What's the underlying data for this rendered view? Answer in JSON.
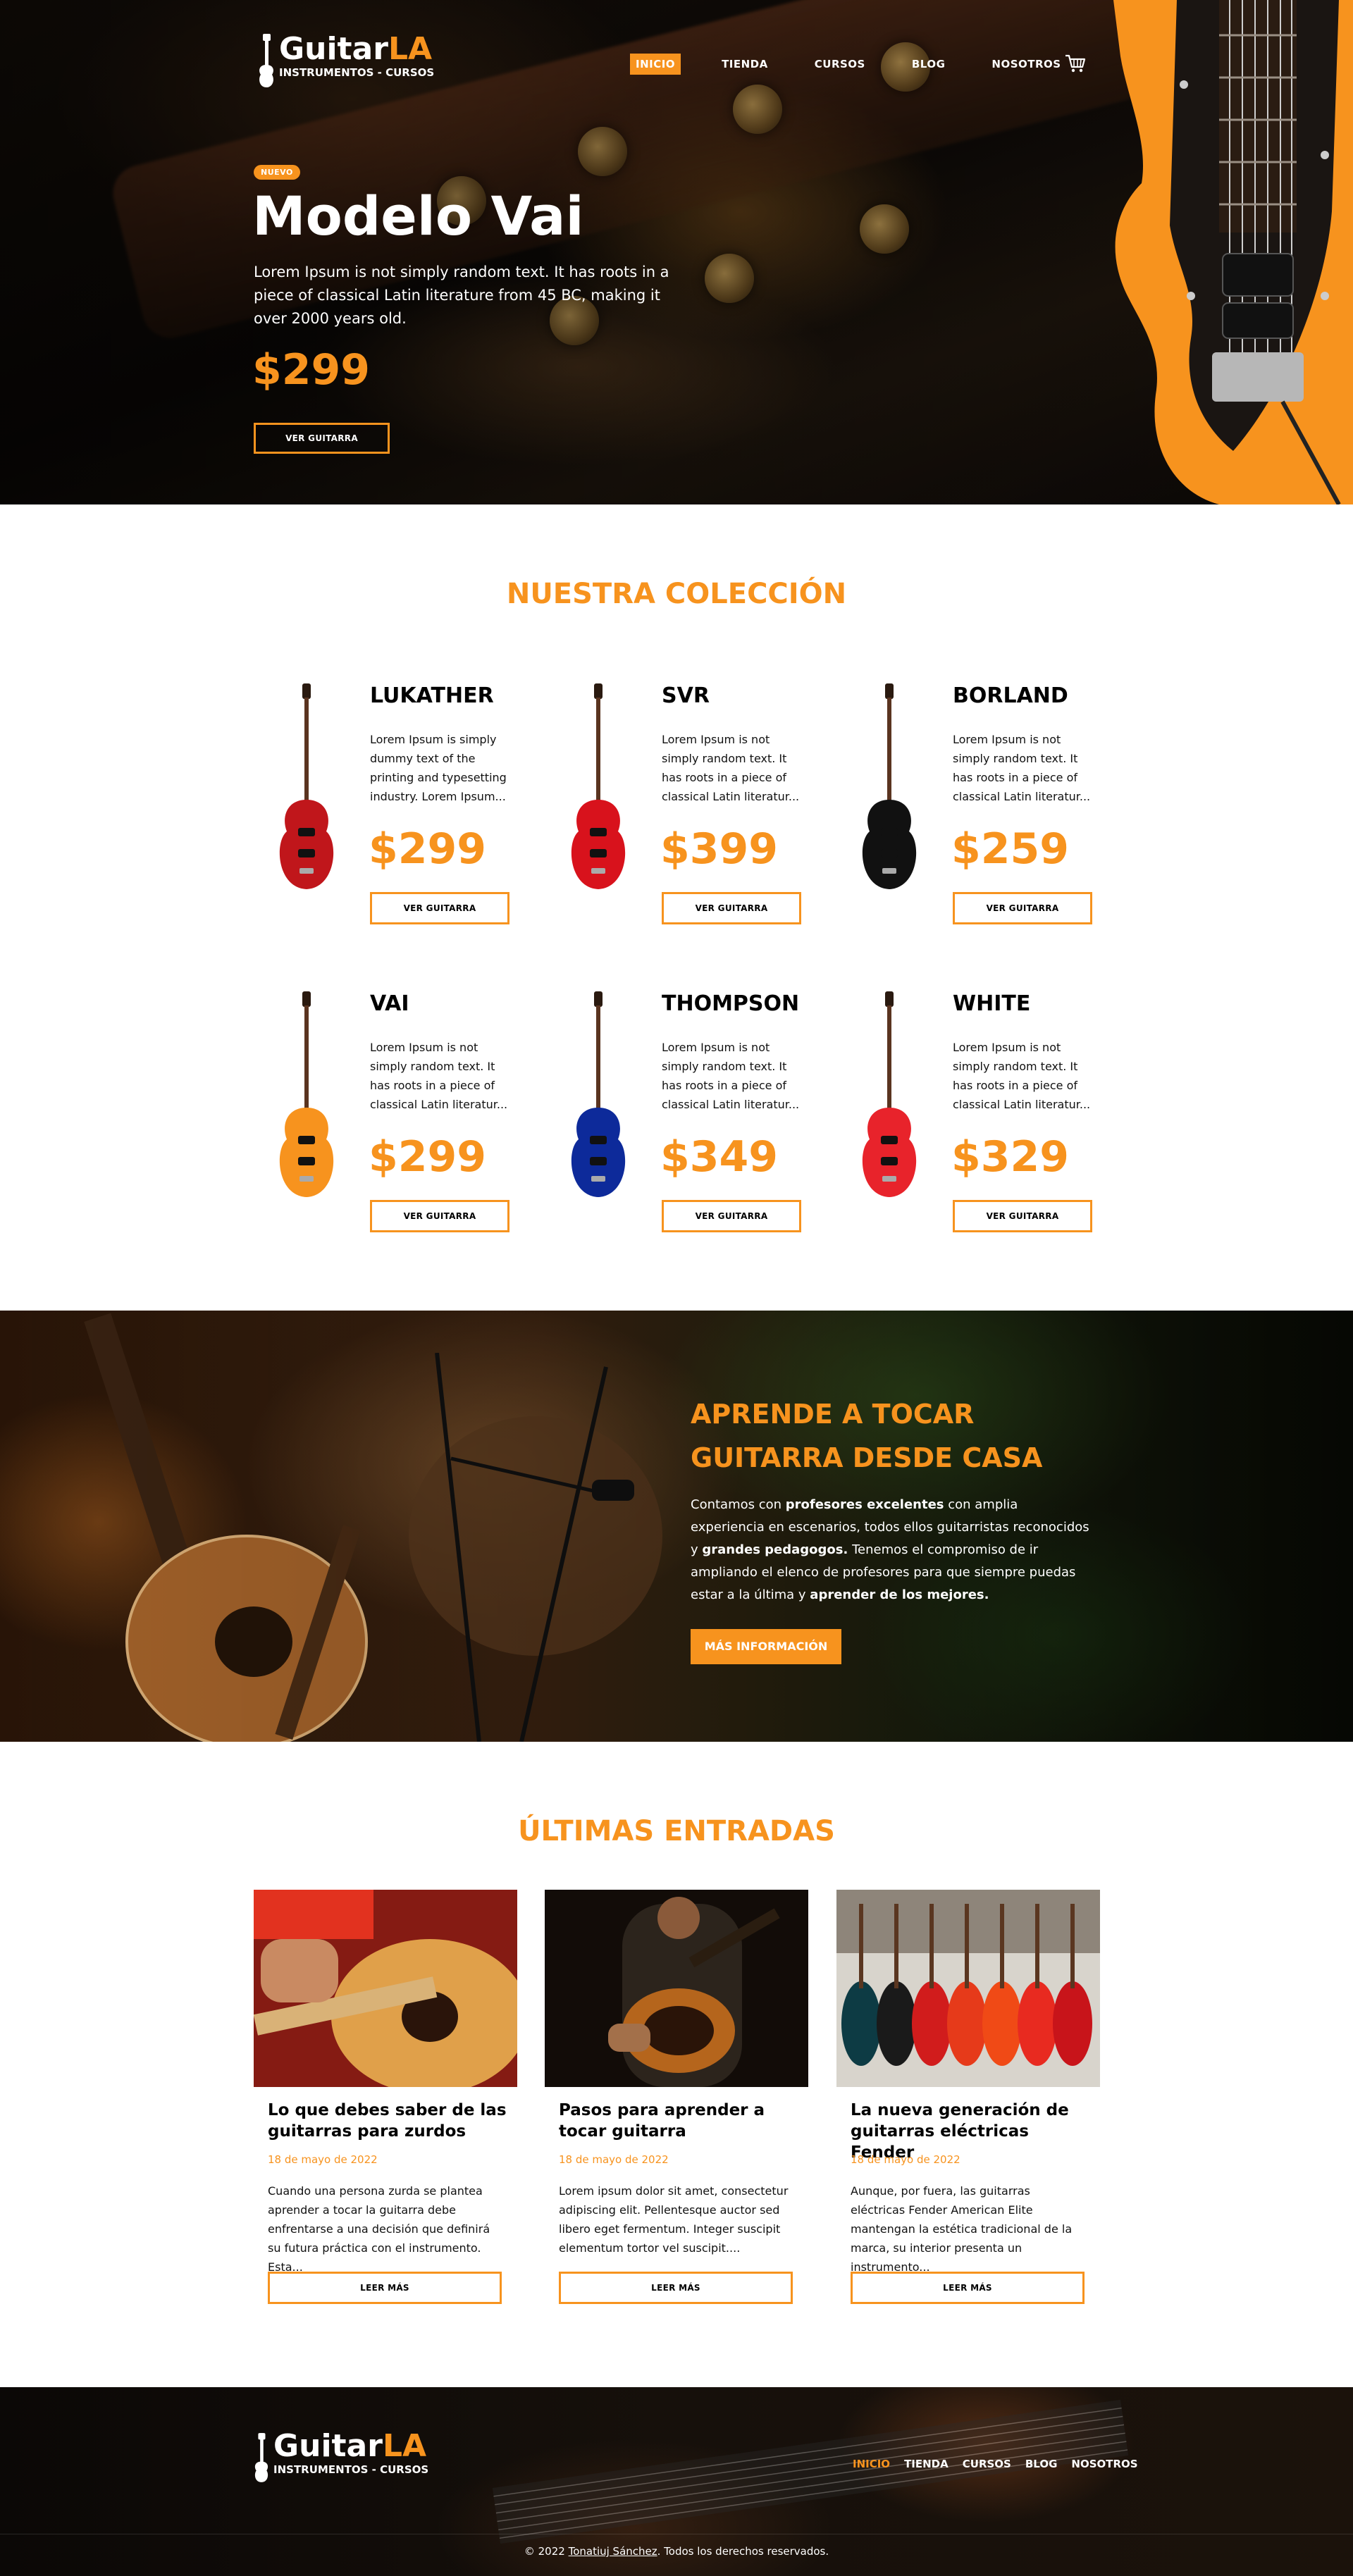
{
  "brand": {
    "name_main": "Guitar",
    "name_accent": "LA",
    "tagline": "INSTRUMENTOS - CURSOS"
  },
  "nav": [
    "INICIO",
    "TIENDA",
    "CURSOS",
    "BLOG",
    "NOSOTROS"
  ],
  "hero": {
    "badge": "NUEVO",
    "title": "Modelo Vai",
    "text": "Lorem Ipsum is not simply random text. It has roots in a piece of classical Latin literature from 45 BC, making it over 2000 years old.",
    "price": "$299",
    "button": "VER GUITARRA"
  },
  "collection": {
    "title": "NUESTRA COLECCIÓN",
    "items": [
      {
        "name": "LUKATHER",
        "desc": "Lorem Ipsum is simply dummy text of the printing and typesetting industry. Lorem Ipsum...",
        "price": "$299",
        "button": "VER GUITARRA",
        "color": "#c0161b"
      },
      {
        "name": "SVR",
        "desc": "Lorem Ipsum is not simply random text. It has roots in a piece of classical Latin literatur...",
        "price": "$399",
        "button": "VER GUITARRA",
        "color": "#d8121c"
      },
      {
        "name": "BORLAND",
        "desc": "Lorem Ipsum is not simply random text. It has roots in a piece of classical Latin literatur...",
        "price": "$259",
        "button": "VER GUITARRA",
        "color": "#111111"
      },
      {
        "name": "VAI",
        "desc": "Lorem Ipsum is not simply random text. It has roots in a piece of classical Latin literatur...",
        "price": "$299",
        "button": "VER GUITARRA",
        "color": "#f7931e"
      },
      {
        "name": "THOMPSON",
        "desc": "Lorem Ipsum is not simply random text. It has roots in a piece of classical Latin literatur...",
        "price": "$349",
        "button": "VER GUITARRA",
        "color": "#0d2a9a"
      },
      {
        "name": "WHITE",
        "desc": "Lorem Ipsum is not simply random text. It has roots in a piece of classical Latin literatur...",
        "price": "$329",
        "button": "VER GUITARRA",
        "color": "#e8232b"
      }
    ]
  },
  "courses": {
    "title_line1": "APRENDE A TOCAR",
    "title_line2": "GUITARRA DESDE CASA",
    "text_1": "Contamos con ",
    "text_b1": "profesores excelentes",
    "text_2": " con amplia experiencia en escenarios, todos ellos guitarristas reconocidos y ",
    "text_b2": "grandes pedagogos.",
    "text_3": " Tenemos el compromiso de ir ampliando el elenco de profesores para que siempre puedas estar a la última y ",
    "text_b3": "aprender de los mejores.",
    "button": "MÁS INFORMACIÓN"
  },
  "blog": {
    "title": "ÚLTIMAS ENTRADAS",
    "posts": [
      {
        "title": "Lo que debes saber de las guitarras para zurdos",
        "date": "18 de mayo de 2022",
        "text": "Cuando una persona zurda se plantea aprender a tocar la guitarra debe enfrentarse a una decisión que definirá su futura práctica con el instrumento. Esta...",
        "button": "LEER MÁS"
      },
      {
        "title": "Pasos para aprender a tocar guitarra",
        "date": "18 de mayo de 2022",
        "text": "Lorem ipsum dolor sit amet, consectetur adipiscing elit. Pellentesque auctor sed libero eget fermentum. Integer suscipit elementum tortor vel suscipit....",
        "button": "LEER MÁS"
      },
      {
        "title": "La nueva generación de guitarras eléctricas Fender",
        "date": "18 de mayo de 2022",
        "text": "Aunque, por fuera, las guitarras eléctricas Fender American Elite mantengan la estética tradicional de la marca, su interior presenta un instrumento...",
        "button": "LEER MÁS"
      }
    ]
  },
  "footer": {
    "nav": [
      "INICIO",
      "TIENDA",
      "CURSOS",
      "BLOG",
      "NOSOTROS"
    ],
    "copy_pre": "© 2022 ",
    "copy_link": "Tonatiuj Sánchez",
    "copy_post": ". Todos los derechos reservados."
  },
  "colors": {
    "accent": "#f7931e",
    "dark": "#000000",
    "light": "#ffffff"
  }
}
